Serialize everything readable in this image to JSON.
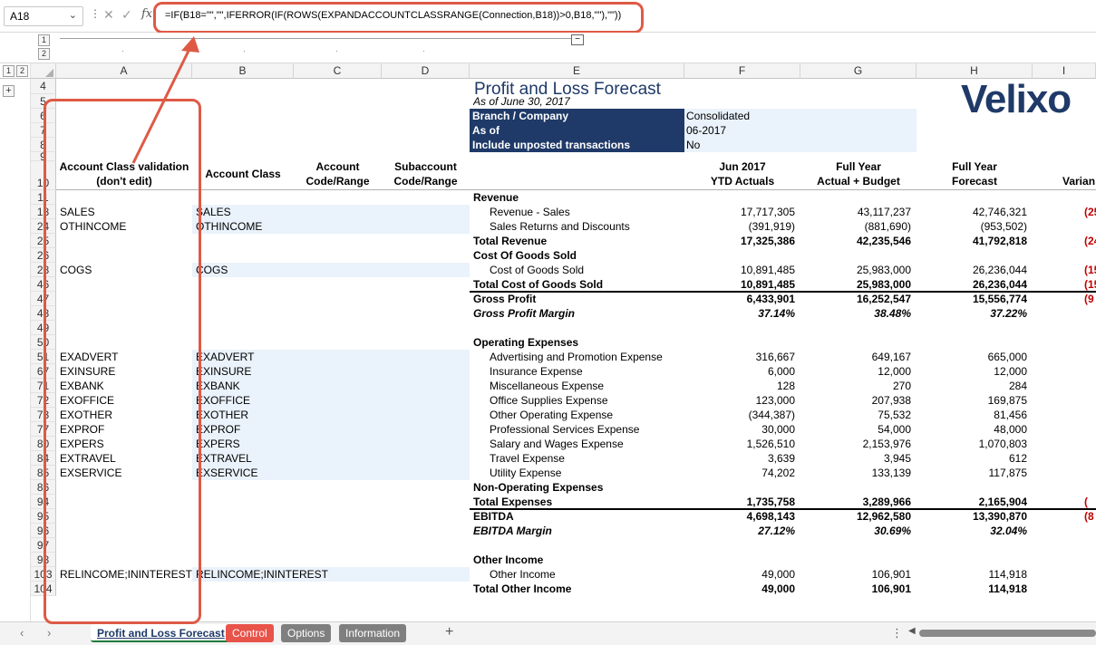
{
  "formula_bar": {
    "name_box": "A18",
    "fx_label": "fx",
    "formula": "=IF(B18=\"\",\"\",IFERROR(IF(ROWS(EXPANDACCOUNTCLASSRANGE(Connection,B18))>0,B18,\"\"),\"\"))"
  },
  "outline": {
    "levels": [
      "1",
      "2"
    ],
    "row_levels": [
      "1",
      "2"
    ],
    "expand": "+",
    "collapse": "−"
  },
  "columns": [
    "A",
    "B",
    "C",
    "D",
    "E",
    "F",
    "G",
    "H",
    "I"
  ],
  "rows": [
    "4",
    "5",
    "6",
    "7",
    "8",
    "9",
    "10",
    "11",
    "18",
    "24",
    "25",
    "26",
    "28",
    "46",
    "47",
    "48",
    "49",
    "50",
    "51",
    "67",
    "71",
    "72",
    "73",
    "77",
    "80",
    "84",
    "85",
    "86",
    "94",
    "95",
    "96",
    "97",
    "98",
    "103",
    "104"
  ],
  "report": {
    "title": "Profit and Loss Forecast",
    "as_of_line": "As of June 30, 2017",
    "params": [
      {
        "label": "Branch / Company",
        "value": "Consolidated"
      },
      {
        "label": "As of",
        "value": "06-2017"
      },
      {
        "label": "Include unposted transactions",
        "value": "No"
      }
    ],
    "logo": "Velixo"
  },
  "headers": {
    "a_line1": "Account Class validation",
    "a_line2": "(don't edit)",
    "b": "Account Class",
    "c_line1": "Account",
    "c_line2": "Code/Range",
    "d_line1": "Subaccount",
    "d_line2": "Code/Range",
    "f_line1": "Jun 2017",
    "f_line2": "YTD Actuals",
    "g_line1": "Full Year",
    "g_line2": "Actual + Budget",
    "h_line1": "Full Year",
    "h_line2": "Forecast",
    "i_line2": "Varian"
  },
  "lines": [
    {
      "a": "",
      "b": "",
      "e": "Revenue",
      "f": "",
      "g": "",
      "h": "",
      "i": "",
      "style": "bold"
    },
    {
      "a": "SALES",
      "b": "SALES",
      "e": "Revenue - Sales",
      "f": "17,717,305",
      "g": "43,117,237",
      "h": "42,746,321",
      "i": "(25",
      "style": "indent"
    },
    {
      "a": "OTHINCOME",
      "b": "OTHINCOME",
      "e": "Sales Returns and Discounts",
      "f": "(391,919)",
      "g": "(881,690)",
      "h": "(953,502)",
      "i": "",
      "style": "indent"
    },
    {
      "a": "",
      "b": "",
      "e": "Total Revenue",
      "f": "17,325,386",
      "g": "42,235,546",
      "h": "41,792,818",
      "i": "(24",
      "style": "bold"
    },
    {
      "a": "",
      "b": "",
      "e": "Cost Of Goods Sold",
      "f": "",
      "g": "",
      "h": "",
      "i": "",
      "style": "bold"
    },
    {
      "a": "COGS",
      "b": "COGS",
      "e": "Cost of Goods Sold",
      "f": "10,891,485",
      "g": "25,983,000",
      "h": "26,236,044",
      "i": "(15",
      "style": "indent"
    },
    {
      "a": "",
      "b": "",
      "e": "Total Cost of Goods Sold",
      "f": "10,891,485",
      "g": "25,983,000",
      "h": "26,236,044",
      "i": "(15",
      "style": "bold"
    },
    {
      "a": "",
      "b": "",
      "e": "Gross Profit",
      "f": "6,433,901",
      "g": "16,252,547",
      "h": "15,556,774",
      "i": "(9",
      "style": "bold"
    },
    {
      "a": "",
      "b": "",
      "e": "Gross Profit Margin",
      "f": "37.14%",
      "g": "38.48%",
      "h": "37.22%",
      "i": "",
      "style": "bolditalic"
    },
    {
      "a": "",
      "b": "",
      "e": "",
      "f": "",
      "g": "",
      "h": "",
      "i": "",
      "style": ""
    },
    {
      "a": "",
      "b": "",
      "e": "Operating Expenses",
      "f": "",
      "g": "",
      "h": "",
      "i": "",
      "style": "bold"
    },
    {
      "a": "EXADVERT",
      "b": "EXADVERT",
      "e": "Advertising and Promotion Expense",
      "f": "316,667",
      "g": "649,167",
      "h": "665,000",
      "i": "",
      "style": "indent"
    },
    {
      "a": "EXINSURE",
      "b": "EXINSURE",
      "e": "Insurance Expense",
      "f": "6,000",
      "g": "12,000",
      "h": "12,000",
      "i": "",
      "style": "indent"
    },
    {
      "a": "EXBANK",
      "b": "EXBANK",
      "e": "Miscellaneous Expense",
      "f": "128",
      "g": "270",
      "h": "284",
      "i": "",
      "style": "indent"
    },
    {
      "a": "EXOFFICE",
      "b": "EXOFFICE",
      "e": "Office Supplies Expense",
      "f": "123,000",
      "g": "207,938",
      "h": "169,875",
      "i": "",
      "style": "indent"
    },
    {
      "a": "EXOTHER",
      "b": "EXOTHER",
      "e": "Other Operating Expense",
      "f": "(344,387)",
      "g": "75,532",
      "h": "81,456",
      "i": "",
      "style": "indent"
    },
    {
      "a": "EXPROF",
      "b": "EXPROF",
      "e": "Professional Services Expense",
      "f": "30,000",
      "g": "54,000",
      "h": "48,000",
      "i": "",
      "style": "indent"
    },
    {
      "a": "EXPERS",
      "b": "EXPERS",
      "e": "Salary and Wages Expense",
      "f": "1,526,510",
      "g": "2,153,976",
      "h": "1,070,803",
      "i": "",
      "style": "indent"
    },
    {
      "a": "EXTRAVEL",
      "b": "EXTRAVEL",
      "e": "Travel Expense",
      "f": "3,639",
      "g": "3,945",
      "h": "612",
      "i": "",
      "style": "indent"
    },
    {
      "a": "EXSERVICE",
      "b": "EXSERVICE",
      "e": "Utility Expense",
      "f": "74,202",
      "g": "133,139",
      "h": "117,875",
      "i": "",
      "style": "indent"
    },
    {
      "a": "",
      "b": "",
      "e": "Non-Operating Expenses",
      "f": "",
      "g": "",
      "h": "",
      "i": "",
      "style": "bold"
    },
    {
      "a": "",
      "b": "",
      "e": "Total Expenses",
      "f": "1,735,758",
      "g": "3,289,966",
      "h": "2,165,904",
      "i": "(",
      "style": "bold"
    },
    {
      "a": "",
      "b": "",
      "e": "EBITDA",
      "f": "4,698,143",
      "g": "12,962,580",
      "h": "13,390,870",
      "i": "(8",
      "style": "bold"
    },
    {
      "a": "",
      "b": "",
      "e": "EBITDA Margin",
      "f": "27.12%",
      "g": "30.69%",
      "h": "32.04%",
      "i": "",
      "style": "bolditalic"
    },
    {
      "a": "",
      "b": "",
      "e": "",
      "f": "",
      "g": "",
      "h": "",
      "i": "",
      "style": ""
    },
    {
      "a": "",
      "b": "",
      "e": "Other Income",
      "f": "",
      "g": "",
      "h": "",
      "i": "",
      "style": "bold"
    },
    {
      "a": "RELINCOME;ININTEREST",
      "b": "RELINCOME;ININTEREST",
      "e": "Other Income",
      "f": "49,000",
      "g": "106,901",
      "h": "114,918",
      "i": "",
      "style": "indent"
    },
    {
      "a": "",
      "b": "",
      "e": "Total Other Income",
      "f": "49,000",
      "g": "106,901",
      "h": "114,918",
      "i": "",
      "style": "bold"
    }
  ],
  "tabs": [
    {
      "label": "Profit and Loss Forecast",
      "color": "#ffffff",
      "active": true
    },
    {
      "label": "Control",
      "color": "#e8534a",
      "active": false
    },
    {
      "label": "Options",
      "color": "#7f7f7f",
      "active": false
    },
    {
      "label": "Information",
      "color": "#7f7f7f",
      "active": false
    }
  ],
  "tab_add": "+",
  "colors": {
    "accent": "#1f3a68",
    "callout": "#de5a45",
    "negative": "#c00000",
    "fill": "#eaf2fb"
  }
}
